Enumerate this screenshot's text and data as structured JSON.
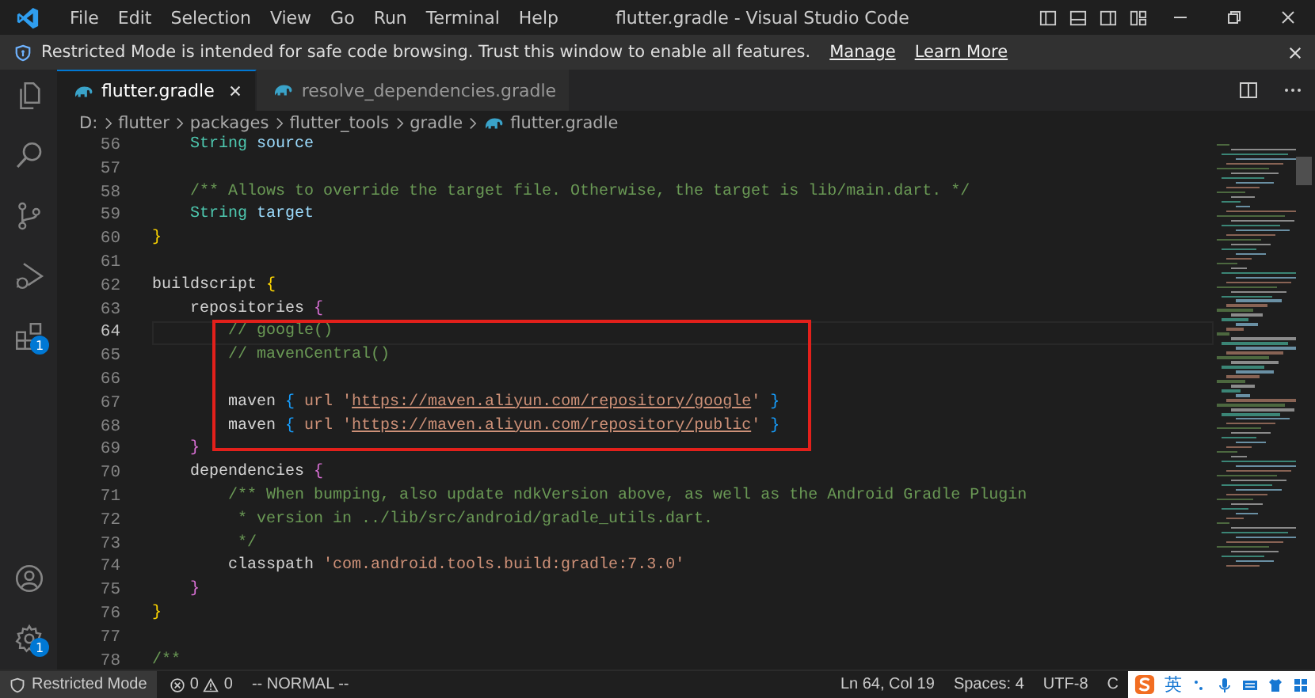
{
  "title_bar": {
    "menu": [
      "File",
      "Edit",
      "Selection",
      "View",
      "Go",
      "Run",
      "Terminal",
      "Help"
    ],
    "title": "flutter.gradle - Visual Studio Code"
  },
  "banner": {
    "message": "Restricted Mode is intended for safe code browsing. Trust this window to enable all features.",
    "links": [
      "Manage",
      "Learn More"
    ]
  },
  "activity_bar": {
    "top": [
      {
        "kind": "files"
      },
      {
        "kind": "search"
      },
      {
        "kind": "source-control"
      },
      {
        "kind": "run"
      },
      {
        "kind": "extensions",
        "badge": "1"
      }
    ],
    "bottom": [
      {
        "kind": "account"
      },
      {
        "kind": "settings",
        "badge": "1"
      }
    ]
  },
  "tabs": [
    {
      "label": "flutter.gradle",
      "selected": true
    },
    {
      "label": "resolve_dependencies.gradle",
      "selected": false
    }
  ],
  "breadcrumb": [
    "D:",
    "flutter",
    "packages",
    "flutter_tools",
    "gradle",
    "flutter.gradle"
  ],
  "editor": {
    "lines": [
      {
        "kind": "line",
        "number": "56",
        "current": false,
        "tokens": [
          {
            "text": "    String",
            "kind": "type"
          },
          {
            "text": " source",
            "kind": "var"
          }
        ]
      },
      {
        "kind": "line",
        "number": "57",
        "current": false
      },
      {
        "kind": "line",
        "number": "58",
        "current": false,
        "tokens": [
          {
            "text": "    /** Allows to override the target file. Otherwise, the target is lib/main.dart. */",
            "kind": "comment"
          }
        ]
      },
      {
        "kind": "line",
        "number": "59",
        "current": false,
        "tokens": [
          {
            "text": "    String",
            "kind": "type"
          },
          {
            "text": " target",
            "kind": "var"
          }
        ]
      },
      {
        "kind": "line",
        "number": "60",
        "current": false,
        "tokens": [
          {
            "text": "}",
            "kind": "brace1"
          }
        ]
      },
      {
        "kind": "line",
        "number": "61",
        "current": false
      },
      {
        "kind": "line",
        "number": "62",
        "current": false,
        "tokens": [
          {
            "text": "buildscript",
            "kind": "plain"
          },
          {
            "text": " {",
            "kind": "brace1"
          }
        ]
      },
      {
        "kind": "line",
        "number": "63",
        "current": false,
        "tokens": [
          {
            "text": "    repositories",
            "kind": "plain"
          },
          {
            "text": " {",
            "kind": "brace2"
          }
        ]
      },
      {
        "kind": "highlight",
        "lines": [
          {
            "number": "64",
            "current": true,
            "tokens": [
              {
                "text": "        // google()",
                "kind": "comment"
              }
            ]
          },
          {
            "number": "65",
            "current": false,
            "tokens": [
              {
                "text": "        // mavenCentral()",
                "kind": "comment"
              }
            ]
          },
          {
            "number": "66",
            "current": false
          },
          {
            "number": "67",
            "current": false,
            "tokens": [
              {
                "text": "        maven",
                "kind": "plain"
              },
              {
                "text": " {",
                "kind": "brace3"
              },
              {
                "text": " url '",
                "kind": "string"
              },
              {
                "text": "https://maven.aliyun.com/repository/google",
                "kind": "url"
              },
              {
                "text": "'",
                "kind": "string"
              },
              {
                "text": " }",
                "kind": "brace3"
              }
            ]
          },
          {
            "number": "68",
            "current": false,
            "tokens": [
              {
                "text": "        maven",
                "kind": "plain"
              },
              {
                "text": " {",
                "kind": "brace3"
              },
              {
                "text": " url '",
                "kind": "string"
              },
              {
                "text": "https://maven.aliyun.com/repository/public",
                "kind": "url"
              },
              {
                "text": "'",
                "kind": "string"
              },
              {
                "text": " }",
                "kind": "brace3"
              }
            ]
          }
        ]
      },
      {
        "kind": "line",
        "number": "69",
        "current": false,
        "tokens": [
          {
            "text": "    }",
            "kind": "brace2"
          }
        ]
      },
      {
        "kind": "line",
        "number": "70",
        "current": false,
        "tokens": [
          {
            "text": "    dependencies",
            "kind": "plain"
          },
          {
            "text": " {",
            "kind": "brace2"
          }
        ]
      },
      {
        "kind": "line",
        "number": "71",
        "current": false,
        "tokens": [
          {
            "text": "        /** When bumping, also update ndkVersion above, as well as the Android Gradle Plugin",
            "kind": "comment"
          }
        ]
      },
      {
        "kind": "line",
        "number": "72",
        "current": false,
        "tokens": [
          {
            "text": "         * version in ../lib/src/android/gradle_utils.dart.",
            "kind": "comment"
          }
        ]
      },
      {
        "kind": "line",
        "number": "73",
        "current": false,
        "tokens": [
          {
            "text": "         */",
            "kind": "comment"
          }
        ]
      },
      {
        "kind": "line",
        "number": "74",
        "current": false,
        "tokens": [
          {
            "text": "        classpath",
            "kind": "plain"
          },
          {
            "text": " 'com.android.tools.build:gradle:7.3.0'",
            "kind": "string"
          }
        ]
      },
      {
        "kind": "line",
        "number": "75",
        "current": false,
        "tokens": [
          {
            "text": "    }",
            "kind": "brace2"
          }
        ]
      },
      {
        "kind": "line",
        "number": "76",
        "current": false,
        "tokens": [
          {
            "text": "}",
            "kind": "brace1"
          }
        ]
      },
      {
        "kind": "line",
        "number": "77",
        "current": false
      },
      {
        "kind": "line",
        "number": "78",
        "current": false,
        "tokens": [
          {
            "text": "/**",
            "kind": "comment"
          }
        ]
      }
    ]
  },
  "status_bar": {
    "mode": "Restricted Mode",
    "errors": "0",
    "warnings": "0",
    "vim_mode": "-- NORMAL --",
    "right": [
      "Ln 64, Col 19",
      "Spaces: 4",
      "UTF-8",
      "C"
    ]
  },
  "ime_bar": {
    "language": "英"
  }
}
